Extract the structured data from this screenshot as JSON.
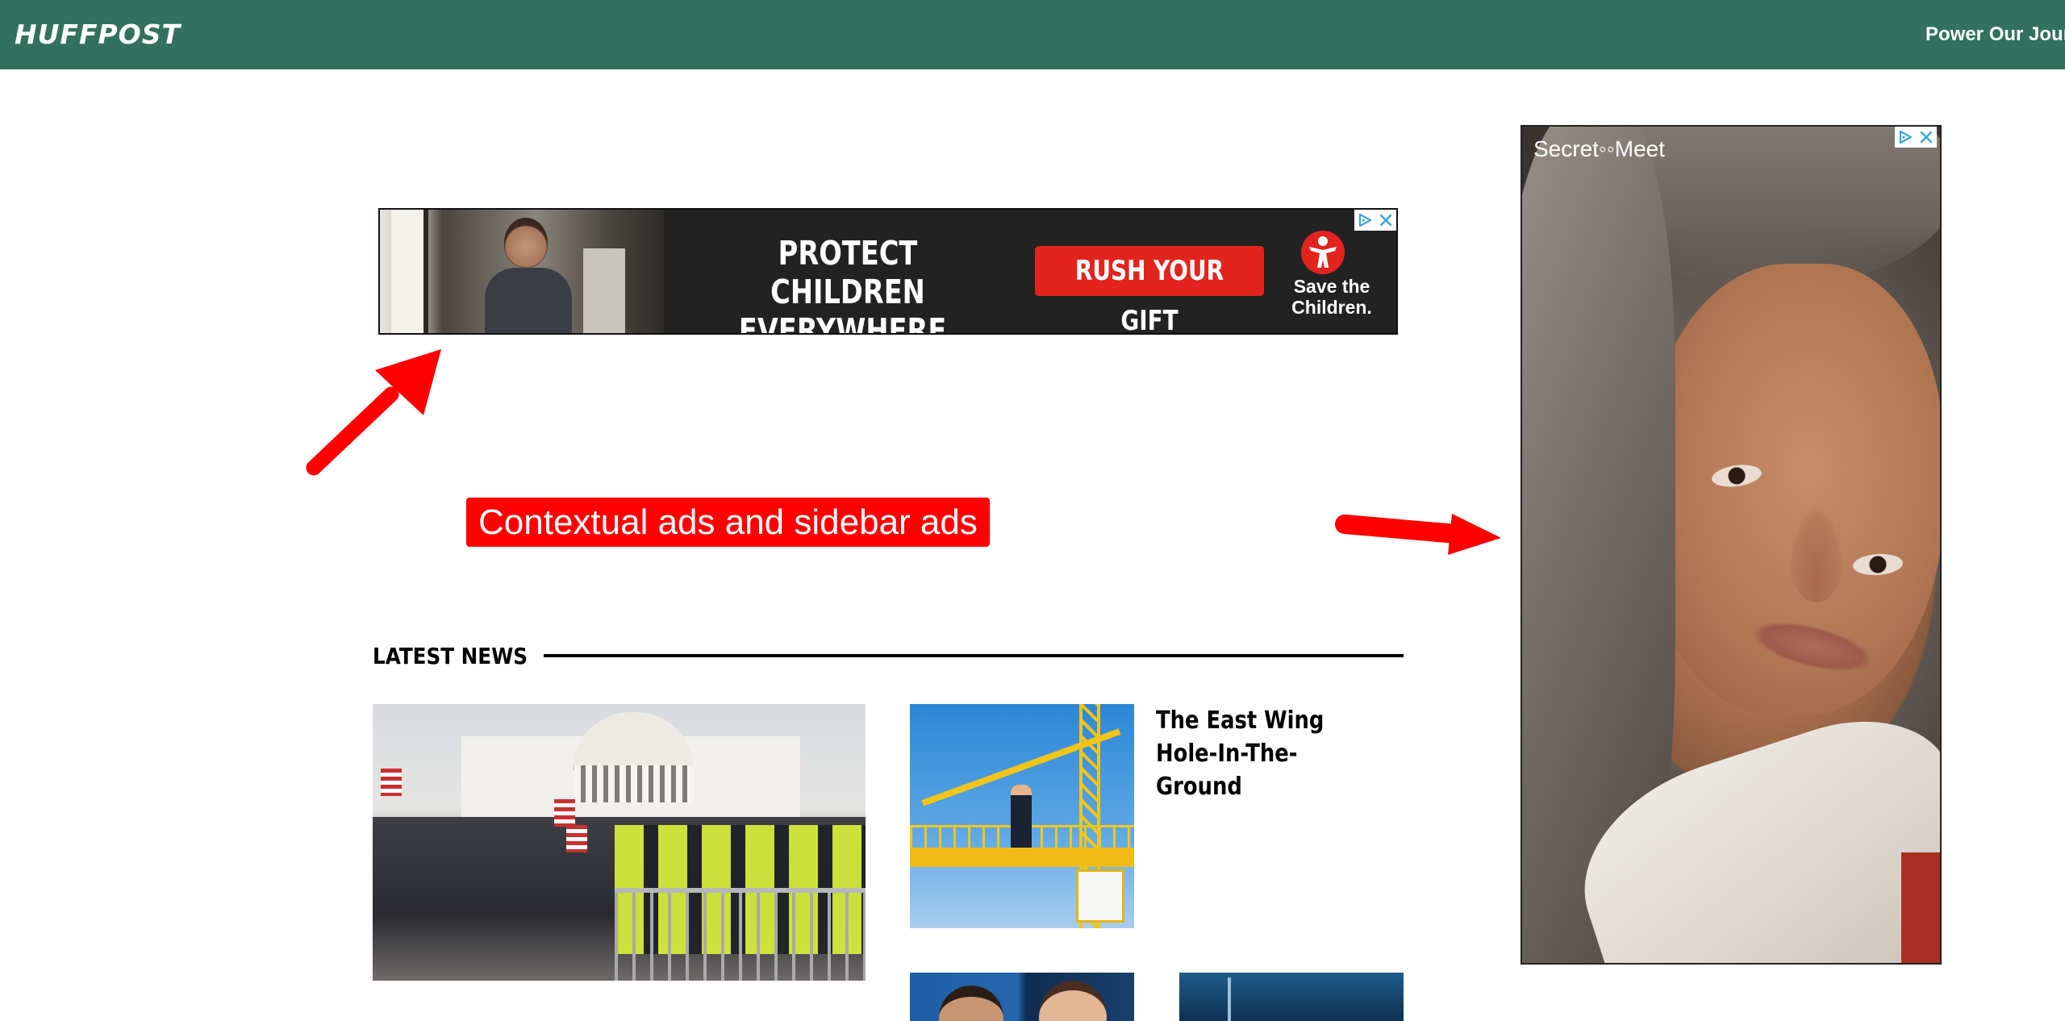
{
  "header": {
    "logo": "HUFFPOST",
    "cta_link": "Power Our Jour",
    "background_color": "#33715f"
  },
  "banner_ad": {
    "headline": "PROTECT CHILDREN\nEVERYWHERE.",
    "cta_label": "RUSH YOUR GIFT",
    "brand": "Save the\nChildren.",
    "accent_color": "#e2241f",
    "icons": [
      "adchoices-icon",
      "close-icon",
      "save-the-children-logo"
    ]
  },
  "annotation": {
    "label": "Contextual ads and sidebar ads",
    "color": "#fe0000",
    "icons": [
      "arrow-up-right-icon",
      "arrow-right-icon"
    ]
  },
  "latest_news": {
    "heading": "LATEST NEWS",
    "articles": [
      {
        "title": "The East Wing\nHole-In-The-\nGround"
      }
    ]
  },
  "sidebar_ad": {
    "brand": "Secret◦◦Meet",
    "icons": [
      "adchoices-icon",
      "close-icon"
    ]
  }
}
